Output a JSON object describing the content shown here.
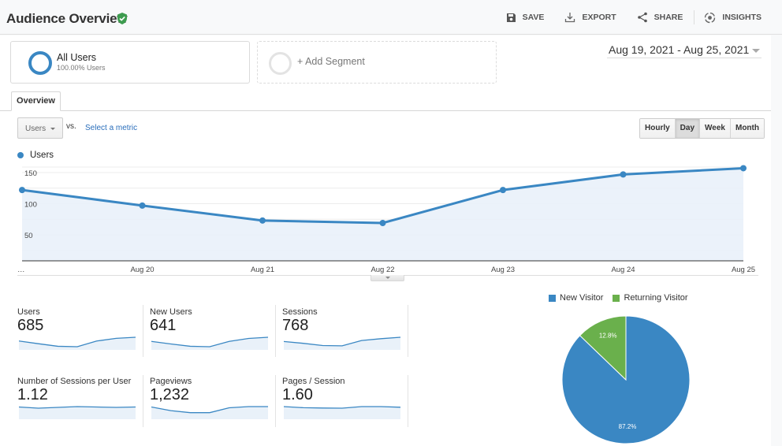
{
  "header": {
    "title": "Audience Overview",
    "verified_icon": "shield-check-icon",
    "actions": [
      {
        "label": "SAVE",
        "icon": "save-icon"
      },
      {
        "label": "EXPORT",
        "icon": "download-icon"
      },
      {
        "label": "SHARE",
        "icon": "share-icon"
      },
      {
        "label": "INSIGHTS",
        "icon": "insights-icon"
      }
    ]
  },
  "segments": {
    "active": {
      "name": "All Users",
      "subtitle": "100.00% Users"
    },
    "add_label": "+ Add Segment"
  },
  "date_range": "Aug 19, 2021 - Aug 25, 2021",
  "tabs": [
    {
      "label": "Overview",
      "active": true
    }
  ],
  "chart_controls": {
    "metric": "Users",
    "vs_label": "vs.",
    "select_metric": "Select a metric",
    "granularity": [
      {
        "label": "Hourly",
        "active": false
      },
      {
        "label": "Day",
        "active": true
      },
      {
        "label": "Week",
        "active": false
      },
      {
        "label": "Month",
        "active": false
      }
    ]
  },
  "colors": {
    "primary": "#3a87c3",
    "area_fill": "#e9f1f9",
    "returning": "#6ab04c",
    "verified": "#3e9c4f"
  },
  "chart_data": [
    {
      "type": "line",
      "title": "",
      "legend": [
        "Users"
      ],
      "legend_position": "top-left",
      "x": [
        "…",
        "Aug 20",
        "Aug 21",
        "Aug 22",
        "Aug 23",
        "Aug 24",
        "Aug 25"
      ],
      "series": [
        {
          "name": "Users",
          "values": [
            122,
            97,
            73,
            69,
            122,
            147,
            157
          ]
        }
      ],
      "yticks": [
        50,
        100,
        150
      ],
      "ylim": [
        0,
        160
      ],
      "grid": true,
      "xlabel": "",
      "ylabel": ""
    },
    {
      "type": "pie",
      "legend": [
        "New Visitor",
        "Returning Visitor"
      ],
      "legend_position": "top",
      "slices": [
        {
          "label": "New Visitor",
          "value": 87.2,
          "display": "87.2%"
        },
        {
          "label": "Returning Visitor",
          "value": 12.8,
          "display": "12.8%"
        }
      ]
    }
  ],
  "metrics": [
    {
      "label": "Users",
      "value": "685",
      "spark": [
        122,
        97,
        73,
        69,
        122,
        147,
        157
      ]
    },
    {
      "label": "New Users",
      "value": "641",
      "spark": [
        112,
        90,
        70,
        66,
        112,
        138,
        148
      ]
    },
    {
      "label": "Sessions",
      "value": "768",
      "spark": [
        130,
        112,
        90,
        87,
        140,
        158,
        172
      ]
    },
    {
      "label": "Number of Sessions per User",
      "value": "1.12",
      "spark": [
        1.13,
        1.1,
        1.12,
        1.14,
        1.13,
        1.12,
        1.13
      ]
    },
    {
      "label": "Pageviews",
      "value": "1,232",
      "spark": [
        210,
        165,
        140,
        140,
        200,
        215,
        215
      ]
    },
    {
      "label": "Pages / Session",
      "value": "1.60",
      "spark": [
        1.62,
        1.55,
        1.53,
        1.52,
        1.62,
        1.62,
        1.58
      ]
    }
  ]
}
